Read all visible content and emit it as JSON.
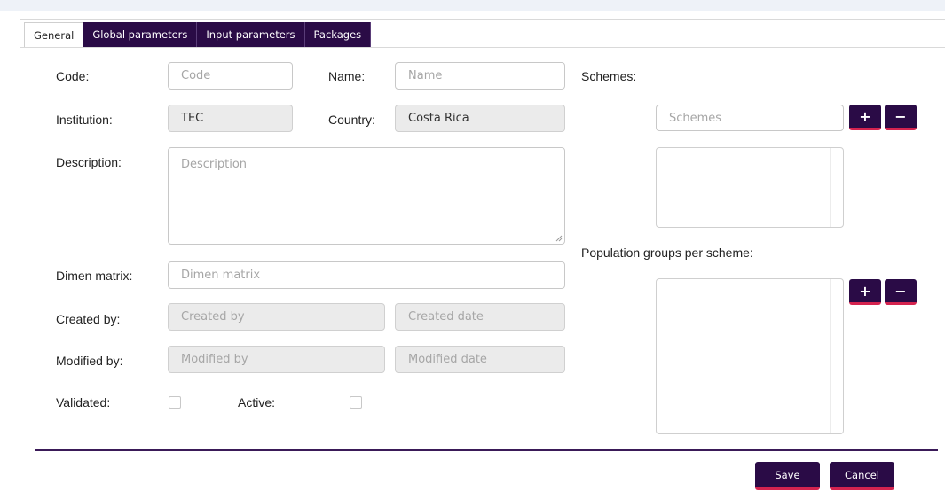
{
  "tabs": [
    "General",
    "Global parameters",
    "Input parameters",
    "Packages"
  ],
  "form": {
    "code_label": "Code:",
    "code_placeholder": "Code",
    "name_label": "Name:",
    "name_placeholder": "Name",
    "institution_label": "Institution:",
    "institution_value": "TEC",
    "country_label": "Country:",
    "country_value": "Costa Rica",
    "description_label": "Description:",
    "description_placeholder": "Description",
    "dimen_label": "Dimen matrix:",
    "dimen_placeholder": "Dimen matrix",
    "created_by_label": "Created by:",
    "created_by_placeholder": "Created by",
    "created_date_placeholder": "Created date",
    "modified_by_label": "Modified by:",
    "modified_by_placeholder": "Modified by",
    "modified_date_placeholder": "Modified date",
    "validated_label": "Validated:",
    "validated_checked": false,
    "active_label": "Active:",
    "active_checked": false
  },
  "schemes": {
    "label": "Schemes:",
    "input_placeholder": "Schemes",
    "add_icon": "+",
    "remove_icon": "−"
  },
  "population": {
    "label": "Population groups per scheme:",
    "add_icon": "+",
    "remove_icon": "−"
  },
  "actions": {
    "save_label": "Save",
    "cancel_label": "Cancel"
  },
  "colors": {
    "accent": "#2a0b46",
    "underline": "#d4234f"
  }
}
